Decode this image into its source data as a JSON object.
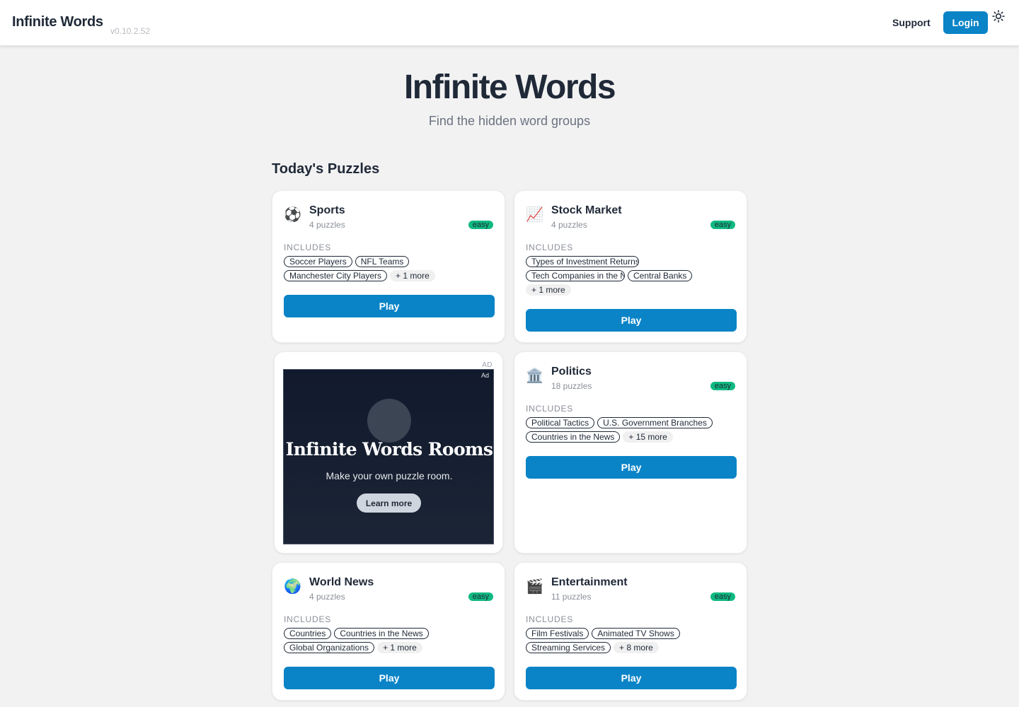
{
  "header": {
    "brand": "Infinite Words",
    "version": "v0.10.2.52",
    "support_label": "Support",
    "login_label": "Login",
    "theme_icon": "sun-icon"
  },
  "hero": {
    "title": "Infinite Words",
    "subtitle": "Find the hidden word groups"
  },
  "section": {
    "title": "Today's Puzzles"
  },
  "includes_label": "INCLUDES",
  "play_label": "Play",
  "cards": [
    {
      "icon": "soccer-ball-icon",
      "emoji": "⚽",
      "title": "Sports",
      "count": "4 puzzles",
      "difficulty": "easy",
      "tags": [
        "Soccer Players",
        "NFL Teams",
        "Manchester City Players"
      ],
      "more": "+ 1 more"
    },
    {
      "icon": "chart-increasing-icon",
      "emoji": "📈",
      "title": "Stock Market",
      "count": "4 puzzles",
      "difficulty": "easy",
      "tags": [
        "Types of Investment Returns",
        "Tech Companies in the News",
        "Central Banks"
      ],
      "more": "+ 1 more"
    },
    {
      "icon": "classical-building-icon",
      "emoji": "🏛️",
      "title": "Politics",
      "count": "18 puzzles",
      "difficulty": "easy",
      "tags": [
        "Political Tactics",
        "U.S. Government Branches",
        "Countries in the News"
      ],
      "more": "+ 15 more"
    },
    {
      "icon": "globe-icon",
      "emoji": "🌍",
      "title": "World News",
      "count": "4 puzzles",
      "difficulty": "easy",
      "tags": [
        "Countries",
        "Countries in the News",
        "Global Organizations"
      ],
      "more": "+ 1 more"
    },
    {
      "icon": "clapper-board-icon",
      "emoji": "🎬",
      "title": "Entertainment",
      "count": "11 puzzles",
      "difficulty": "easy",
      "tags": [
        "Film Festivals",
        "Animated TV Shows",
        "Streaming Services"
      ],
      "more": "+ 8 more"
    }
  ],
  "ad": {
    "label": "AD",
    "corner": "Ad",
    "headline": "Infinite Words Rooms",
    "text": "Make your own puzzle room.",
    "button": "Learn more"
  },
  "colors": {
    "accent": "#0a84c7",
    "badge": "#10b981",
    "background": "#f2f2f2"
  }
}
